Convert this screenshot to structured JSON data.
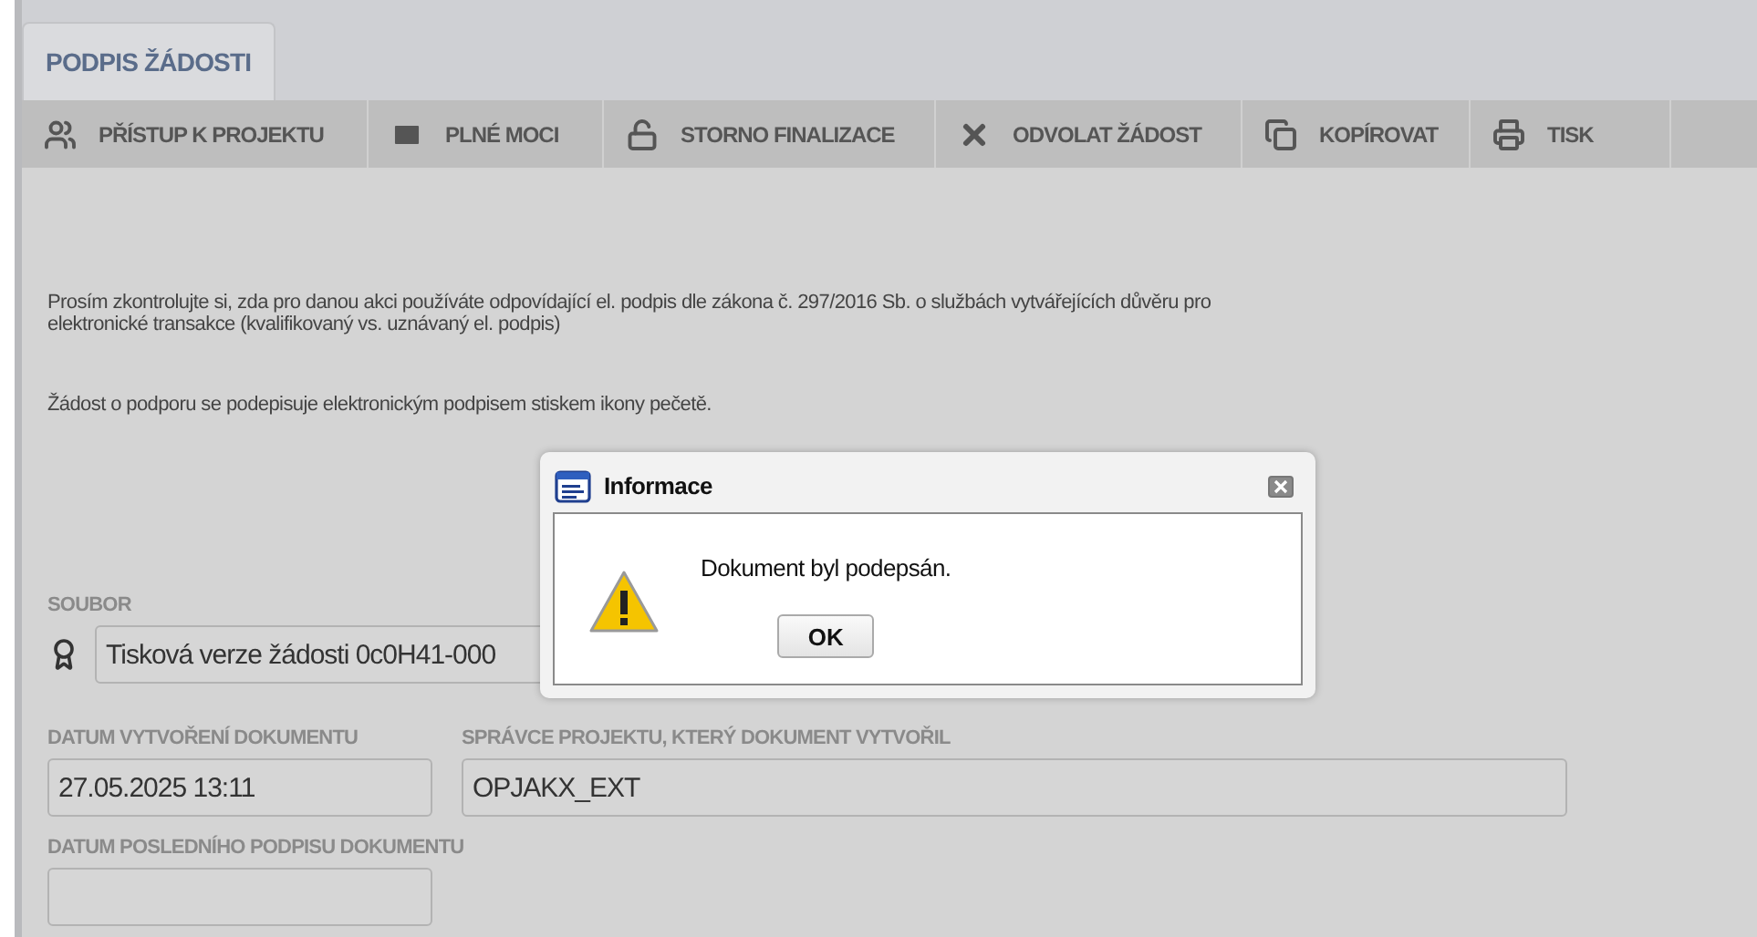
{
  "tabs": [
    {
      "label": "PODPIS ŽÁDOSTI",
      "selected": true
    }
  ],
  "toolbar": [
    {
      "label": "PŘÍSTUP K PROJEKTU"
    },
    {
      "label": "PLNÉ MOCI"
    },
    {
      "label": "STORNO FINALIZACE"
    },
    {
      "label": "ODVOLAT ŽÁDOST"
    },
    {
      "label": "KOPÍROVAT"
    },
    {
      "label": "TISK"
    }
  ],
  "notice": "Prosím zkontrolujte si, zda pro danou akci používáte odpovídající el. podpis dle zákona č. 297/2016 Sb. o službách vytvářejících důvěru pro elektronické transakce (kvalifikovaný vs. uznávaný el. podpis)",
  "hint": "Žádost o podporu se podepisuje elektronickým podpisem stiskem ikony pečetě.",
  "file": {
    "label": "SOUBOR",
    "value": "Tisková verze žádosti 0c0H41-000"
  },
  "created": {
    "label": "DATUM VYTVOŘENÍ DOKUMENTU",
    "value": "27.05.2025 13:11"
  },
  "manager": {
    "label": "SPRÁVCE PROJEKTU, KTERÝ DOKUMENT VYTVOŘIL",
    "value": "OPJAKX_EXT"
  },
  "last_signature": {
    "label": "DATUM POSLEDNÍHO PODPISU DOKUMENTU"
  },
  "dialog": {
    "title": "Informace",
    "message": "Dokument byl podepsán.",
    "button": "OK"
  }
}
